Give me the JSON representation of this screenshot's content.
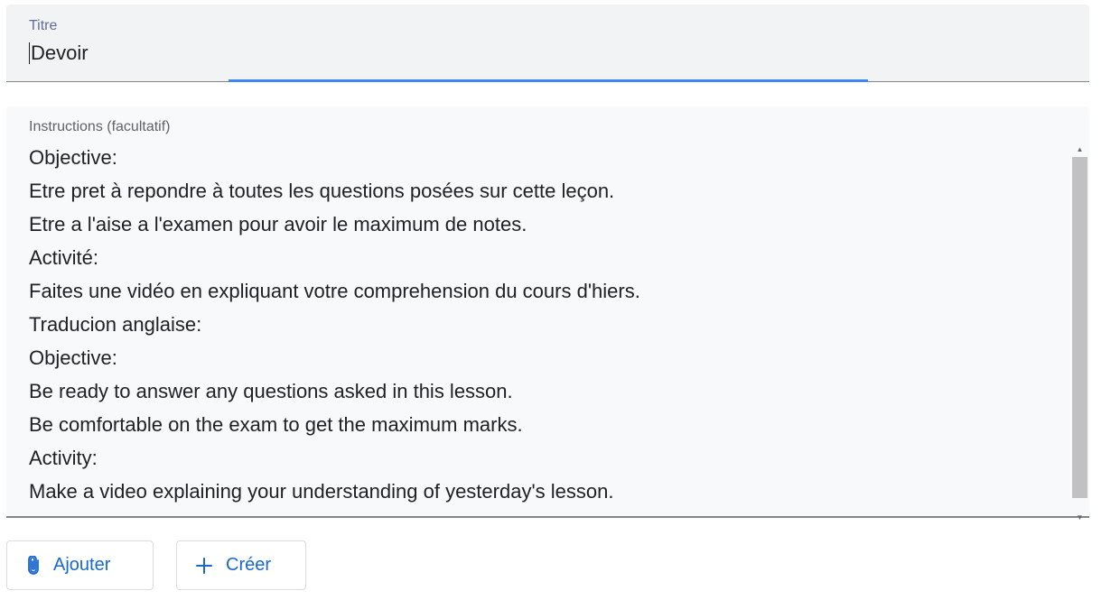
{
  "title_field": {
    "label": "Titre",
    "value": "Devoir"
  },
  "instructions_field": {
    "label": "Instructions (facultatif)",
    "lines": [
      "Objective:",
      "Etre pret à repondre à toutes les questions posées sur cette leçon.",
      "Etre a l'aise a l'examen pour avoir le maximum de notes.",
      "Activité:",
      "Faites une vidéo en expliquant votre comprehension du cours d'hiers.",
      "Traducion anglaise:",
      "Objective:",
      "Be ready to answer any questions asked in this lesson.",
      "Be comfortable on the exam to get the maximum marks.",
      "Activity:",
      "Make a video explaining your understanding of yesterday's lesson."
    ]
  },
  "buttons": {
    "add": {
      "label": "Ajouter",
      "icon": "paperclip-icon"
    },
    "create": {
      "label": "Créer",
      "icon": "plus-icon"
    }
  },
  "colors": {
    "accent": "#4285f4",
    "button_text": "#1967d2",
    "field_bg": "#f1f3f4"
  }
}
